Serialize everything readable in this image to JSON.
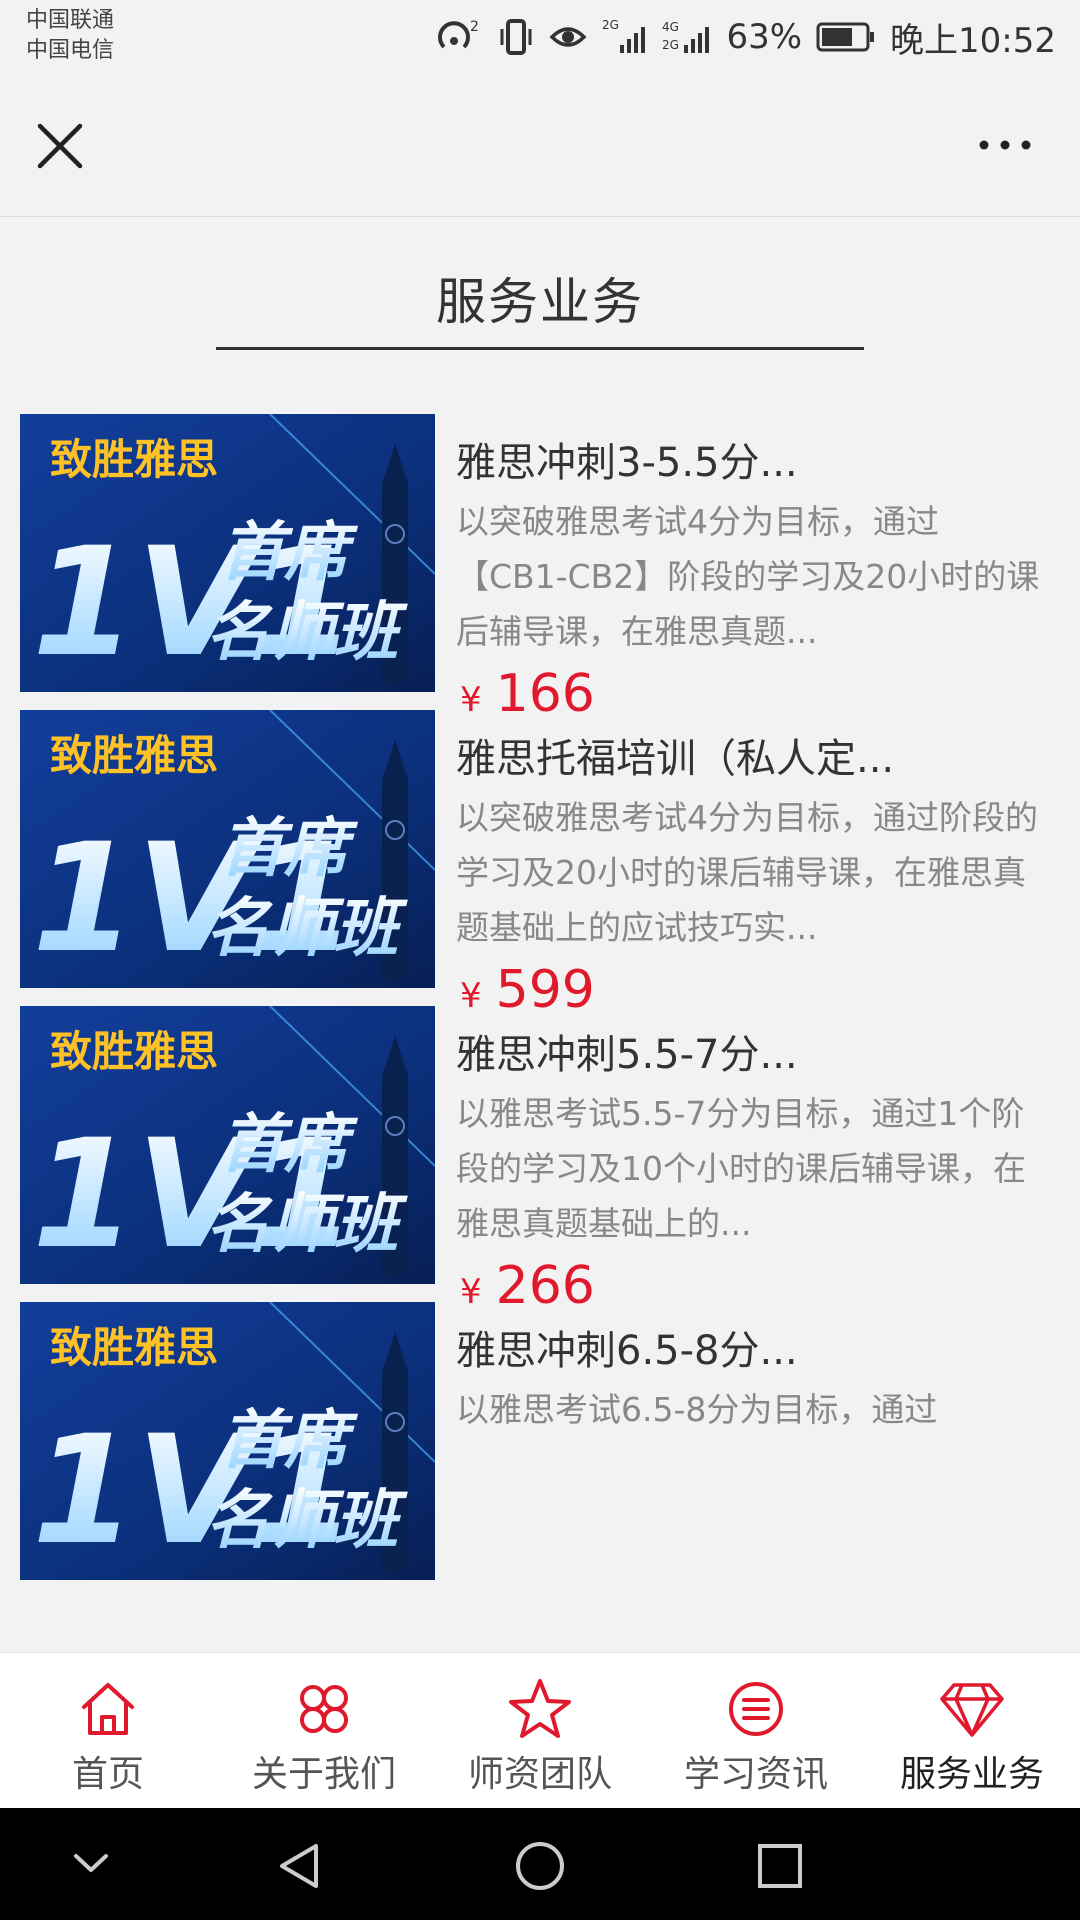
{
  "status_bar": {
    "carrier_1": "中国联通",
    "carrier_2": "中国电信",
    "battery": "63%",
    "time": "晚上10:52",
    "icons": [
      "hotspot-icon",
      "vibrate-icon",
      "eye-comfort-icon",
      "signal-2g-icon",
      "signal-4g-icon",
      "battery-icon"
    ]
  },
  "navbar": {
    "close_icon": "close-icon",
    "more_icon": "more-icon"
  },
  "section": {
    "title": "服务业务"
  },
  "items": [
    {
      "title": "雅思冲刺3-5.5分...",
      "desc": "以突破雅思考试4分为目标，通过【CB1-CB2】阶段的学习及20小时的课后辅导课，在雅思真题...",
      "currency": "¥",
      "price": "166",
      "banner": {
        "brand": "致胜雅思",
        "big": "1V1",
        "line1": "首席",
        "line2": "名师班"
      }
    },
    {
      "title": "雅思托福培训（私人定...",
      "desc": "以突破雅思考试4分为目标，通过阶段的学习及20小时的课后辅导课，在雅思真题基础上的应试技巧实...",
      "currency": "¥",
      "price": "599",
      "banner": {
        "brand": "致胜雅思",
        "big": "1V1",
        "line1": "首席",
        "line2": "名师班"
      }
    },
    {
      "title": "雅思冲刺5.5-7分...",
      "desc": "以雅思考试5.5-7分为目标，通过1个阶段的学习及10个小时的课后辅导课，在雅思真题基础上的...",
      "currency": "¥",
      "price": "266",
      "banner": {
        "brand": "致胜雅思",
        "big": "1V1",
        "line1": "首席",
        "line2": "名师班"
      }
    },
    {
      "title": "雅思冲刺6.5-8分...",
      "desc": "以雅思考试6.5-8分为目标，通过",
      "currency": "",
      "price": "",
      "banner": {
        "brand": "致胜雅思",
        "big": "1V1",
        "line1": "首席",
        "line2": "名师班"
      }
    }
  ],
  "tabbar": {
    "tabs": [
      {
        "label": "首页",
        "icon": "home-icon"
      },
      {
        "label": "关于我们",
        "icon": "clover-icon"
      },
      {
        "label": "师资团队",
        "icon": "star-icon"
      },
      {
        "label": "学习资讯",
        "icon": "list-icon"
      },
      {
        "label": "服务业务",
        "icon": "diamond-icon"
      }
    ],
    "active_index": 4,
    "accent_color": "#e0192d"
  },
  "system_nav": {
    "icons": [
      "collapse-icon",
      "back-icon",
      "home-circle-icon",
      "recents-icon"
    ]
  },
  "colors": {
    "price": "#e0192d",
    "background": "#f2f2f2",
    "banner_blue": "#0b3a8c"
  }
}
